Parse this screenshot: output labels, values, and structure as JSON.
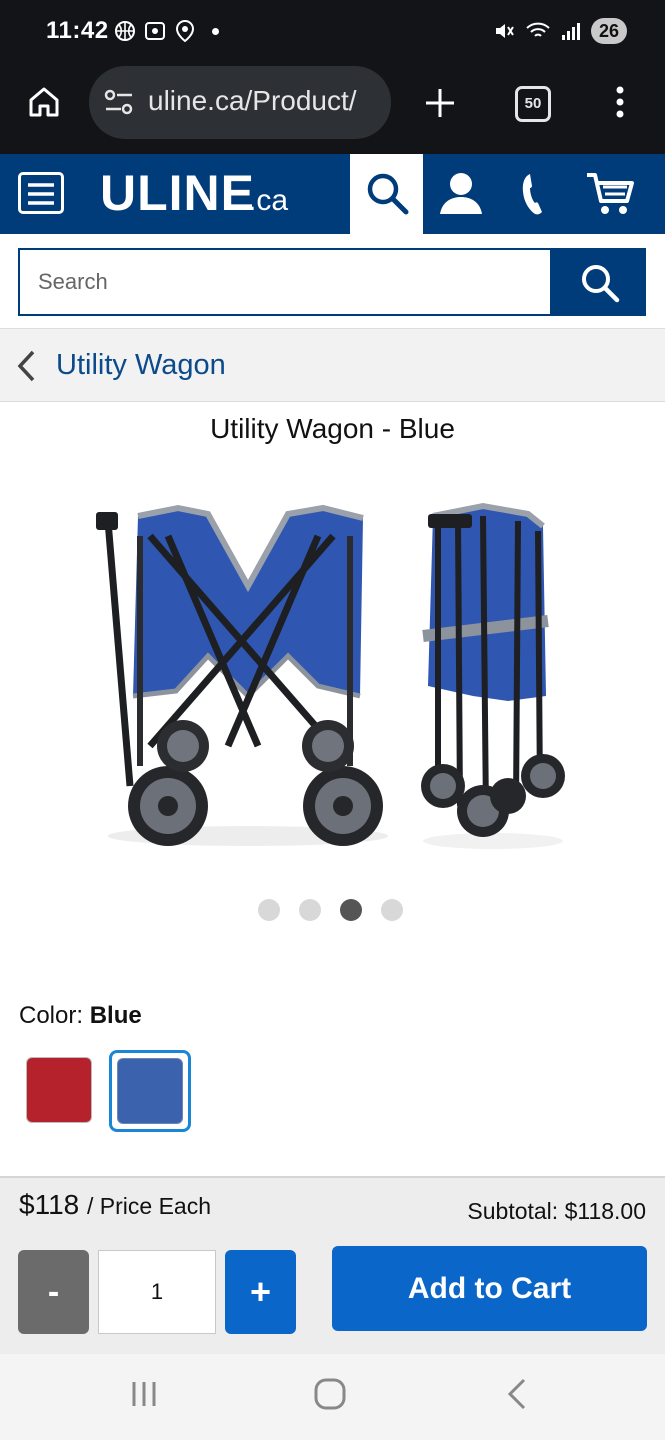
{
  "status_bar": {
    "time": "11:42",
    "battery": "26"
  },
  "browser": {
    "url": "uline.ca/Product/",
    "tab_count": "50"
  },
  "site_header": {
    "logo": "ULINE",
    "logo_tld": ".ca"
  },
  "search": {
    "placeholder": "Search",
    "value": ""
  },
  "breadcrumb": {
    "label": "Utility Wagon"
  },
  "product": {
    "title": "Utility Wagon - Blue",
    "image_icon": "utility-wagon-photo",
    "carousel": {
      "total": 4,
      "active_index": 3
    },
    "color": {
      "label": "Color:",
      "selected": "Blue",
      "swatches": [
        {
          "name": "Red",
          "hex": "#b5222c"
        },
        {
          "name": "Blue",
          "hex": "#3a62ad"
        }
      ]
    }
  },
  "purchase": {
    "price": "$118",
    "price_unit": "/ Price Each",
    "subtotal": "Subtotal: $118.00",
    "qty_minus": "-",
    "qty_value": "1",
    "qty_plus": "+",
    "add_to_cart": "Add to Cart"
  },
  "colors": {
    "brand_navy": "#003b7a",
    "primary_blue": "#0a66c8",
    "selection_outline": "#1a86d6"
  }
}
